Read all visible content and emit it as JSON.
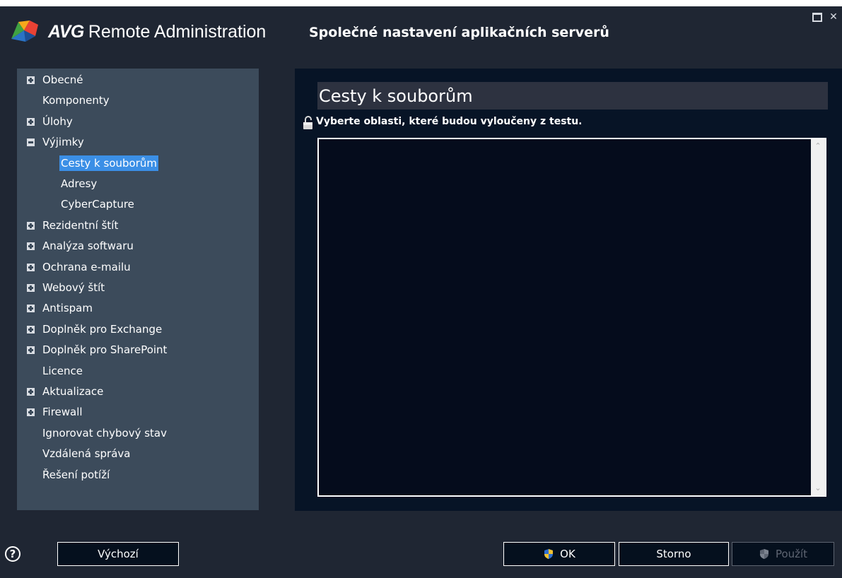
{
  "app": {
    "brand": "AVG",
    "name": "Remote Administration",
    "dialog_title": "Společné nastavení aplikačních serverů",
    "close_glyph": "✕"
  },
  "tree": {
    "items": [
      {
        "label": "Obecné",
        "expander": "plus"
      },
      {
        "label": "Komponenty",
        "expander": ""
      },
      {
        "label": "Úlohy",
        "expander": "plus"
      },
      {
        "label": "Výjimky",
        "expander": "minus"
      },
      {
        "label": "Cesty k souborům",
        "expander": "",
        "selected": true,
        "child": true
      },
      {
        "label": "Adresy",
        "expander": "",
        "child": true
      },
      {
        "label": "CyberCapture",
        "expander": "",
        "child": true
      },
      {
        "label": "Rezidentní štít",
        "expander": "plus"
      },
      {
        "label": "Analýza softwaru",
        "expander": "plus"
      },
      {
        "label": "Ochrana e-mailu",
        "expander": "plus"
      },
      {
        "label": "Webový štít",
        "expander": "plus"
      },
      {
        "label": "Antispam",
        "expander": "plus"
      },
      {
        "label": "Doplněk pro Exchange",
        "expander": "plus"
      },
      {
        "label": "Doplněk pro SharePoint",
        "expander": "plus"
      },
      {
        "label": "Licence",
        "expander": ""
      },
      {
        "label": "Aktualizace",
        "expander": "plus"
      },
      {
        "label": "Firewall",
        "expander": "plus"
      },
      {
        "label": "Ignorovat chybový stav",
        "expander": ""
      },
      {
        "label": "Vzdálená správa",
        "expander": ""
      },
      {
        "label": "Řešení potíží",
        "expander": ""
      }
    ]
  },
  "main": {
    "section_title": "Cesty k souborům",
    "hint": "Vyberte oblasti, které budou vyloučeny z testu.",
    "scroll_up": "⌃",
    "scroll_down": "⌄"
  },
  "footer": {
    "help": "?",
    "default_label": "Výchozí",
    "ok_label": "OK",
    "cancel_label": "Storno",
    "apply_label": "Použít"
  },
  "colors": {
    "accent": "#3b8fe6",
    "tree_bg": "#3c4b5b",
    "panel_bg": "#071426",
    "window_bg": "#1f2633"
  },
  "icons": [
    "avg-logo-icon",
    "maximize-icon",
    "close-icon",
    "plus-expander-icon",
    "minus-expander-icon",
    "lock-icon",
    "help-icon",
    "shield-icon"
  ]
}
